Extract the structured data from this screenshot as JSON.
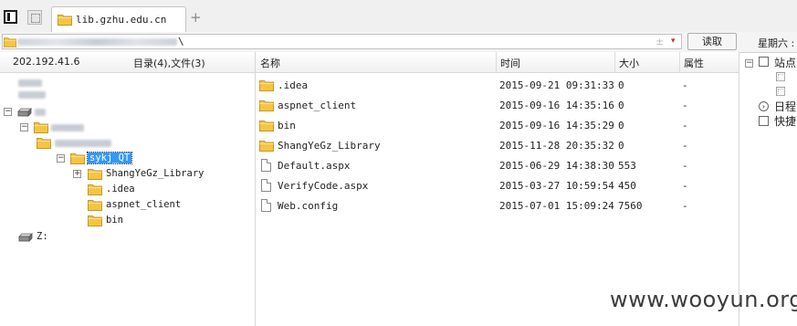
{
  "tabs": {
    "active_label": "lib.gzhu.edu.cn",
    "new_tab_symbol": "+"
  },
  "address": {
    "path_end": "\\",
    "star": "±",
    "dropdown": "▾",
    "read_button": "读取"
  },
  "left_pane": {
    "ip": "202.192.41.6",
    "summary": "目录(4),文件(3)",
    "tree": {
      "selected_folder": "sykj_QT",
      "children": [
        "ShangYeGz_Library",
        ".idea",
        "aspnet_client",
        "bin"
      ],
      "drive_z": "Z:"
    }
  },
  "file_list": {
    "headers": {
      "name": "名称",
      "time": "时间",
      "size": "大小",
      "attr": "属性"
    },
    "rows": [
      {
        "name": ".idea",
        "type": "folder",
        "time": "2015-09-21 09:31:33",
        "size": "0",
        "attr": "-"
      },
      {
        "name": "aspnet_client",
        "type": "folder",
        "time": "2015-09-16 14:35:16",
        "size": "0",
        "attr": "-"
      },
      {
        "name": "bin",
        "type": "folder",
        "time": "2015-09-16 14:35:29",
        "size": "0",
        "attr": "-"
      },
      {
        "name": "ShangYeGz_Library",
        "type": "folder",
        "time": "2015-11-28 20:35:32",
        "size": "0",
        "attr": "-"
      },
      {
        "name": "Default.aspx",
        "type": "file",
        "time": "2015-06-29 14:38:30",
        "size": "553",
        "attr": "-"
      },
      {
        "name": "VerifyCode.aspx",
        "type": "file",
        "time": "2015-03-27 10:59:54",
        "size": "450",
        "attr": "-"
      },
      {
        "name": "Web.config",
        "type": "file",
        "time": "2015-07-01 15:09:24",
        "size": "7560",
        "attr": "-"
      }
    ]
  },
  "right_pane": {
    "weekday": "星期六 :",
    "site_label": "站点",
    "calendar_label": "日程",
    "shortcut_label": "快捷"
  },
  "watermark": "www.wooyun.org",
  "colors": {
    "selection": "#3399ff",
    "folder": "#f5c542",
    "chevron": "#cc3333"
  }
}
